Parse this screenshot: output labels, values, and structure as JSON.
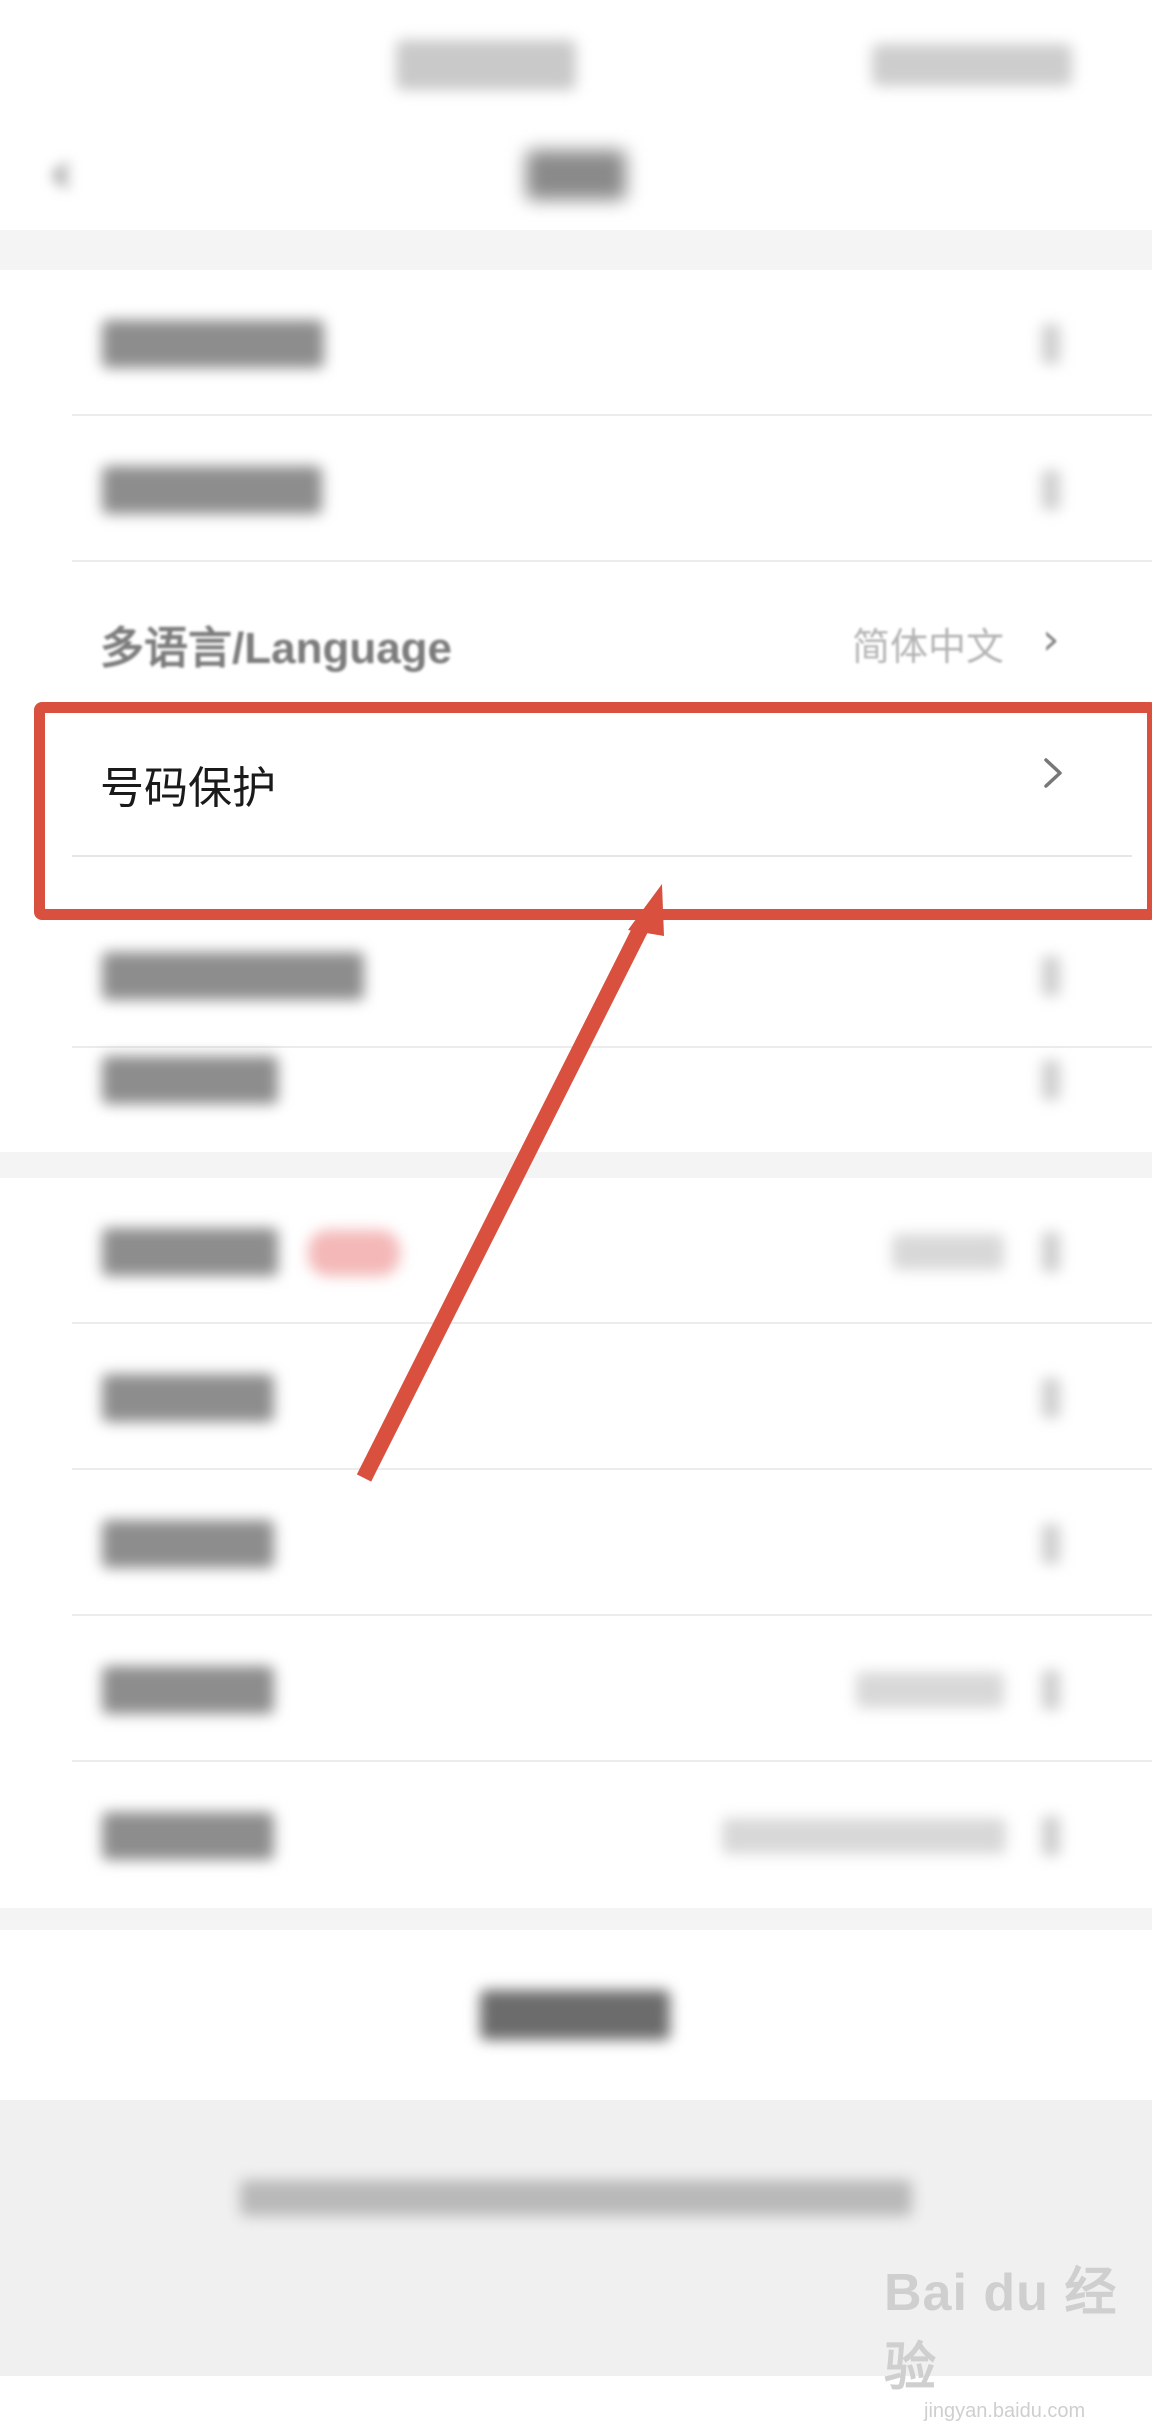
{
  "header": {
    "back_icon": "chevron-left-icon"
  },
  "settings": {
    "language_label": "多语言/Language",
    "language_value": "简体中文",
    "highlighted_label": "号码保护",
    "chevron_icon": "chevron-right-icon"
  },
  "annotation": {
    "frame_color": "#d9503f",
    "arrow_color": "#d9503f"
  },
  "watermark": {
    "brand": "Bai du 经验",
    "url": "jingyan.baidu.com"
  }
}
